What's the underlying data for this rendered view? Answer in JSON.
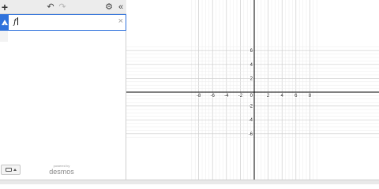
{
  "toolbar": {
    "add_icon": "plus-icon",
    "undo_icon": "undo-icon",
    "redo_icon": "redo-icon",
    "settings_icon": "gear-icon",
    "collapse_icon": "double-chevron-left-icon",
    "add_glyph": "+",
    "undo_glyph": "↶",
    "redo_glyph": "↷",
    "settings_glyph": "⚙",
    "collapse_glyph": "«"
  },
  "expression": {
    "text": "f",
    "status_icon": "warning-icon",
    "delete_glyph": "×"
  },
  "footer": {
    "powered_by": "powered by",
    "brand": "desmos",
    "keyboard_icon": "keyboard-icon"
  },
  "graph": {
    "x_range": [
      -9,
      9
    ],
    "y_range": [
      -6.6,
      6.6
    ],
    "major_step": 2,
    "minor_step": 0.5,
    "x_tick_labels": [
      "-8",
      "-6",
      "-4",
      "-2",
      "0",
      "2",
      "4",
      "6",
      "8"
    ],
    "y_tick_labels": [
      "6",
      "4",
      "2",
      "-2",
      "-4",
      "-6"
    ],
    "axis_color": "#000000",
    "major_grid_color": "#cccccc",
    "minor_grid_color": "#ececec"
  },
  "colors": {
    "accent": "#2f72dc",
    "toolbar_bg": "#ececec"
  }
}
